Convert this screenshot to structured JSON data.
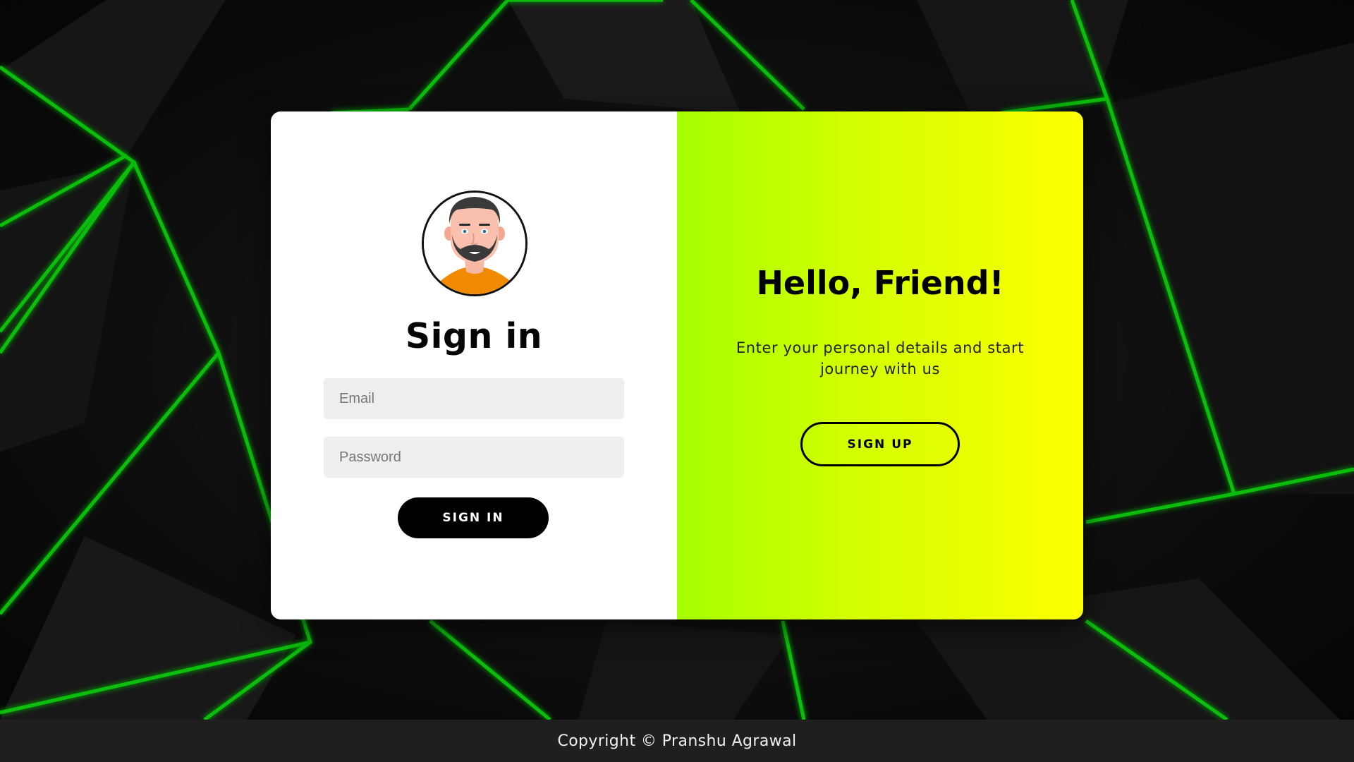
{
  "signin": {
    "title": "Sign in",
    "email_placeholder": "Email",
    "password_placeholder": "Password",
    "button_label": "SIGN IN"
  },
  "welcome": {
    "heading": "Hello, Friend!",
    "text": "Enter your personal details and start journey with us",
    "button_label": "SIGN UP"
  },
  "footer": {
    "copyright": "Copyright © Pranshu Agrawal"
  },
  "colors": {
    "accent_green": "#00c400",
    "gradient_start": "#a6ff00",
    "gradient_end": "#fdff00",
    "avatar_shirt": "#f08a00"
  },
  "icons": {
    "avatar": "user-avatar-icon"
  }
}
